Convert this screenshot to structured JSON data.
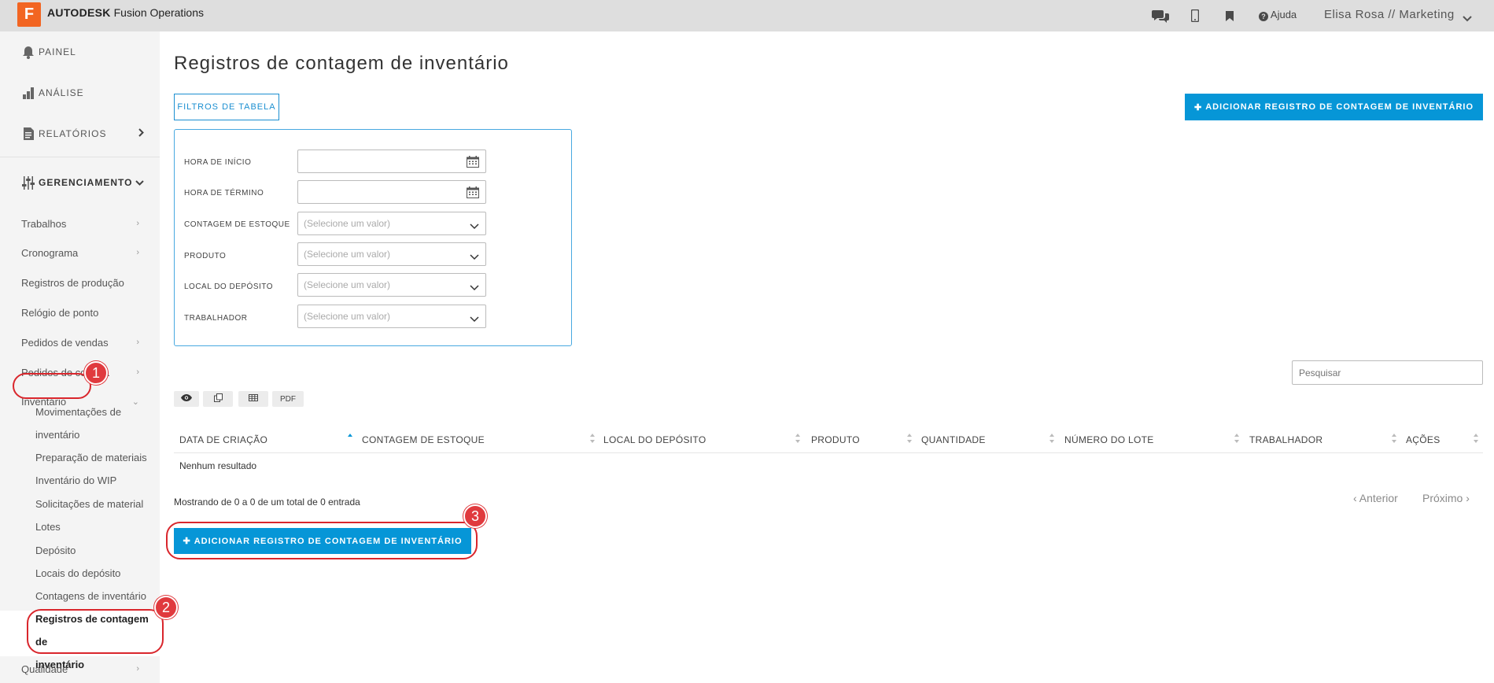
{
  "header": {
    "logo_letter": "F",
    "brand": "AUTODESK",
    "product": "Fusion Operations",
    "help": "Ajuda",
    "user": "Elisa Rosa // Marketing"
  },
  "sidebar": {
    "top": [
      {
        "label": "PAINEL"
      },
      {
        "label": "ANÁLISE"
      },
      {
        "label": "RELATÓRIOS"
      },
      {
        "label": "GERENCIAMENTO"
      }
    ],
    "items": [
      {
        "label": "Trabalhos"
      },
      {
        "label": "Cronograma"
      },
      {
        "label": "Registros de produção"
      },
      {
        "label": "Relógio de ponto"
      },
      {
        "label": "Pedidos de vendas"
      },
      {
        "label": "Pedidos de compra"
      },
      {
        "label": "Inventário"
      }
    ],
    "inventory_items": [
      {
        "label": "Movimentações de"
      },
      {
        "label": "inventário"
      },
      {
        "label": "Preparação de materiais"
      },
      {
        "label": "Inventário do WIP"
      },
      {
        "label": "Solicitações de material"
      },
      {
        "label": "Lotes"
      },
      {
        "label": "Depósito"
      },
      {
        "label": "Locais do depósito"
      },
      {
        "label": "Contagens de inventário"
      },
      {
        "label": "Registros de contagem de"
      },
      {
        "label": "inventário"
      }
    ],
    "bottom": {
      "label": "Qualidade"
    }
  },
  "callouts": [
    "1",
    "2",
    "3"
  ],
  "main": {
    "title": "Registros de contagem de inventário",
    "filters_button": "FILTROS DE TABELA",
    "add_button": "ADICIONAR REGISTRO DE CONTAGEM DE INVENTÁRIO",
    "filters": [
      {
        "label": "HORA DE INÍCIO",
        "placeholder": ""
      },
      {
        "label": "HORA DE TÉRMINO",
        "placeholder": ""
      },
      {
        "label": "CONTAGEM DE ESTOQUE",
        "placeholder": "(Selecione um valor)"
      },
      {
        "label": "PRODUTO",
        "placeholder": "(Selecione um valor)"
      },
      {
        "label": "LOCAL DO DEPÓSITO",
        "placeholder": "(Selecione um valor)"
      },
      {
        "label": "TRABALHADOR",
        "placeholder": "(Selecione um valor)"
      }
    ],
    "search_placeholder": "Pesquisar",
    "toolbar": {
      "pdf": "PDF"
    },
    "columns": [
      {
        "label": "DATA DE CRIAÇÃO"
      },
      {
        "label": "CONTAGEM DE ESTOQUE"
      },
      {
        "label": "LOCAL DO DEPÓSITO"
      },
      {
        "label": "PRODUTO"
      },
      {
        "label": "QUANTIDADE"
      },
      {
        "label": "NÚMERO DO LOTE"
      },
      {
        "label": "TRABALHADOR"
      },
      {
        "label": "AÇÕES"
      }
    ],
    "no_results": "Nenhum resultado",
    "info": "Mostrando de 0 a 0 de um total de 0 entrada",
    "prev": "‹ Anterior",
    "next": "Próximo ›"
  },
  "colors": {
    "accent": "#0696d7",
    "brand": "#f26522",
    "callout": "#d9262c"
  }
}
